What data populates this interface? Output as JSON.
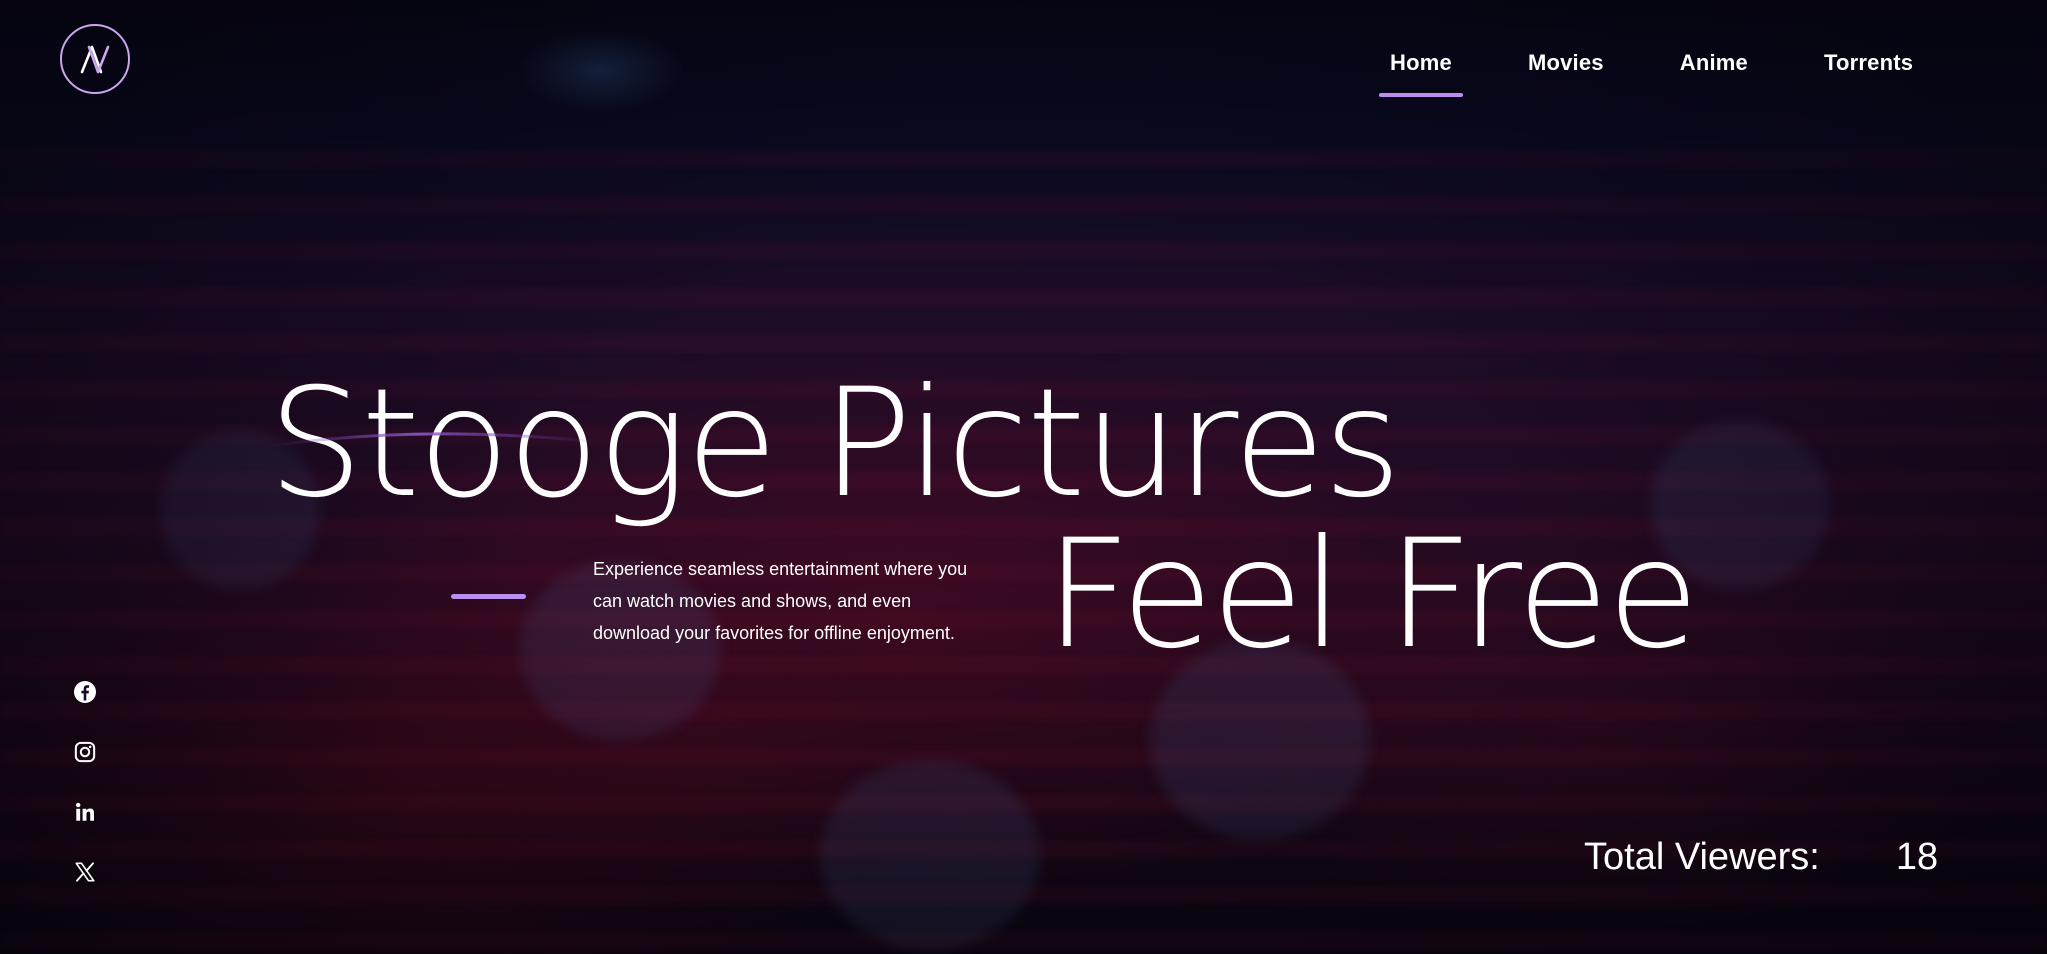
{
  "logo": {
    "icon": "stylized-xm-monogram-icon",
    "ring_color": "#c9a6ee"
  },
  "nav": {
    "items": [
      {
        "label": "Home",
        "active": true
      },
      {
        "label": "Movies",
        "active": false
      },
      {
        "label": "Anime",
        "active": false
      },
      {
        "label": "Torrents",
        "active": false
      }
    ],
    "active_color": "#b98ff0"
  },
  "hero": {
    "title": "Stooge Pictures",
    "description": "Experience seamless entertainment where you can watch movies and shows, and even download your favorites for offline enjoyment.",
    "tagline": "Feel Free",
    "accent_color": "#b98ff0"
  },
  "social": [
    {
      "icon": "facebook-icon"
    },
    {
      "icon": "instagram-icon"
    },
    {
      "icon": "linkedin-icon"
    },
    {
      "icon": "x-twitter-icon"
    }
  ],
  "stats": {
    "viewers_label": "Total Viewers:",
    "viewers_count": "18"
  }
}
